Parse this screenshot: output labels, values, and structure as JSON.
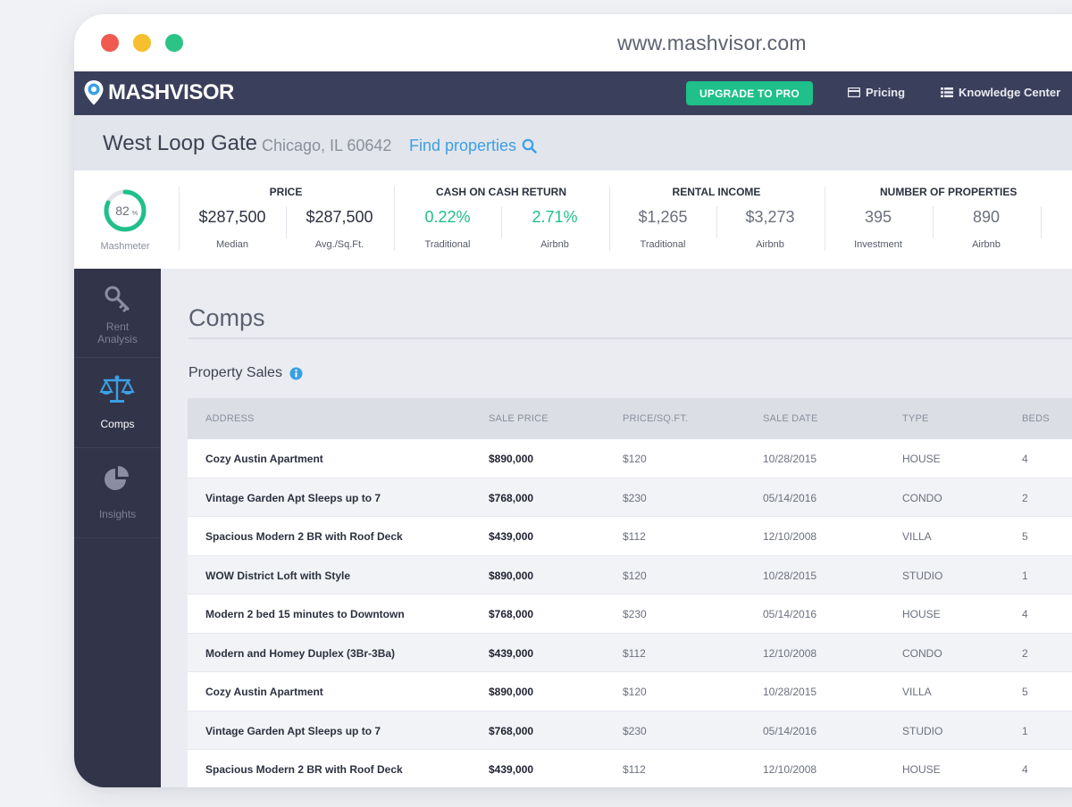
{
  "browser": {
    "url": "www.mashvisor.com"
  },
  "navbar": {
    "logo_text": "MASHVISOR",
    "upgrade_label": "UPGRADE TO PRO",
    "pricing_label": "Pricing",
    "knowledge_label": "Knowledge Center"
  },
  "location": {
    "area": "West Loop Gate",
    "city": "Chicago, IL 60642",
    "find_label": "Find properties"
  },
  "stats": {
    "mashmeter": {
      "value": "82",
      "unit": "%",
      "label": "Mashmeter",
      "fraction": 0.82
    },
    "price": {
      "title": "PRICE",
      "items": [
        {
          "value": "$287,500",
          "label": "Median"
        },
        {
          "value": "$287,500",
          "label": "Avg./Sq.Ft."
        }
      ]
    },
    "cash": {
      "title": "CASH ON CASH RETURN",
      "items": [
        {
          "value": "0.22%",
          "label": "Traditional"
        },
        {
          "value": "2.71%",
          "label": "Airbnb"
        }
      ]
    },
    "rental": {
      "title": "RENTAL INCOME",
      "items": [
        {
          "value": "$1,265",
          "label": "Traditional"
        },
        {
          "value": "$3,273",
          "label": "Airbnb"
        }
      ]
    },
    "properties": {
      "title": "NUMBER OF PROPERTIES",
      "items": [
        {
          "value": "395",
          "label": "Investment"
        },
        {
          "value": "890",
          "label": "Airbnb"
        }
      ]
    }
  },
  "sidebar": {
    "items": [
      {
        "label_line1": "Rent",
        "label_line2": "Analysis",
        "icon": "key-icon"
      },
      {
        "label_line1": "Comps",
        "label_line2": "",
        "icon": "scale-icon"
      },
      {
        "label_line1": "Insights",
        "label_line2": "",
        "icon": "pie-chart-icon"
      }
    ]
  },
  "main": {
    "title": "Comps",
    "subtitle": "Property Sales",
    "columns": [
      "ADDRESS",
      "SALE PRICE",
      "PRICE/SQ.FT.",
      "SALE DATE",
      "TYPE",
      "BEDS"
    ],
    "rows": [
      [
        "Cozy Austin Apartment",
        "$890,000",
        "$120",
        "10/28/2015",
        "HOUSE",
        "4"
      ],
      [
        "Vintage Garden Apt Sleeps up to 7",
        "$768,000",
        "$230",
        "05/14/2016",
        "CONDO",
        "2"
      ],
      [
        "Spacious Modern 2 BR with Roof Deck",
        "$439,000",
        "$112",
        "12/10/2008",
        "VILLA",
        "5"
      ],
      [
        "WOW District Loft with Style",
        "$890,000",
        "$120",
        "10/28/2015",
        "STUDIO",
        "1"
      ],
      [
        "Modern 2 bed 15 minutes to Downtown",
        "$768,000",
        "$230",
        "05/14/2016",
        "HOUSE",
        "4"
      ],
      [
        "Modern and Homey Duplex (3Br-3Ba)",
        "$439,000",
        "$112",
        "12/10/2008",
        "CONDO",
        "2"
      ],
      [
        "Cozy Austin Apartment",
        "$890,000",
        "$120",
        "10/28/2015",
        "VILLA",
        "5"
      ],
      [
        "Vintage Garden Apt Sleeps up to 7",
        "$768,000",
        "$230",
        "05/14/2016",
        "STUDIO",
        "1"
      ],
      [
        "Spacious Modern 2 BR with Roof Deck",
        "$439,000",
        "$112",
        "12/10/2008",
        "HOUSE",
        "4"
      ]
    ]
  },
  "colors": {
    "navbar": "#3a3f5c",
    "accent_green": "#1fc08a",
    "link_blue": "#3aa0e5",
    "sidebar": "#323449"
  }
}
